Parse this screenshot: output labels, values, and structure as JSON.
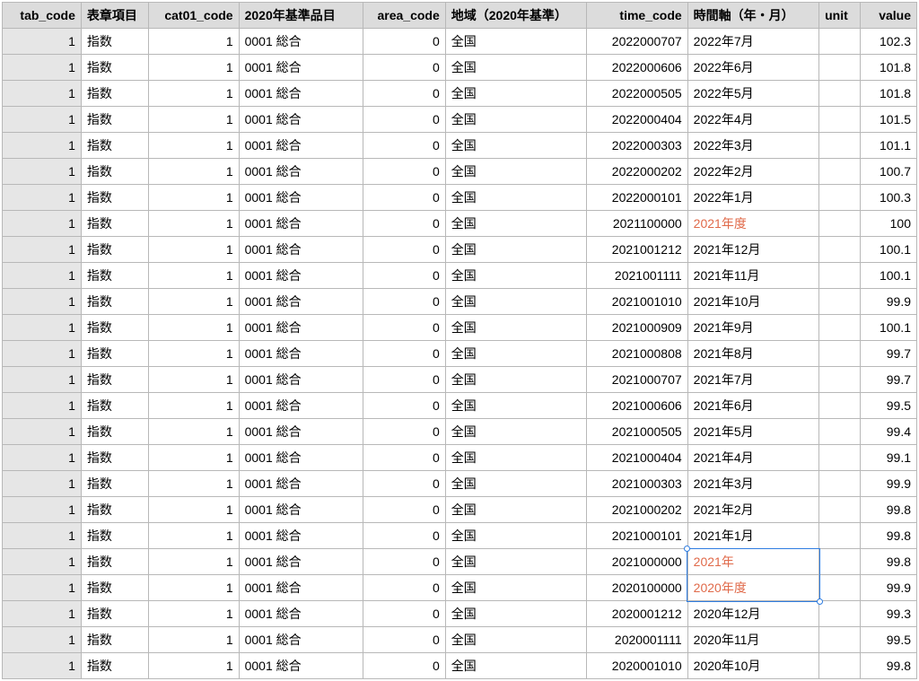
{
  "columns": [
    {
      "key": "tab_code",
      "label": "tab_code",
      "type": "num"
    },
    {
      "key": "hyosho",
      "label": "表章項目",
      "type": "txt"
    },
    {
      "key": "cat01_code",
      "label": "cat01_code",
      "type": "num"
    },
    {
      "key": "hinmoku",
      "label": "2020年基準品目",
      "type": "txt"
    },
    {
      "key": "area_code",
      "label": "area_code",
      "type": "num"
    },
    {
      "key": "chiiki",
      "label": "地域（2020年基準）",
      "type": "txt"
    },
    {
      "key": "time_code",
      "label": "time_code",
      "type": "num"
    },
    {
      "key": "time",
      "label": "時間軸（年・月）",
      "type": "txt"
    },
    {
      "key": "unit",
      "label": "unit",
      "type": "txt"
    },
    {
      "key": "value",
      "label": "value",
      "type": "val"
    }
  ],
  "base": {
    "tab_code": "1",
    "hyosho": "指数",
    "cat01_code": "1",
    "hinmoku": "0001 総合",
    "area_code": "0",
    "chiiki": "全国",
    "unit": ""
  },
  "rows": [
    {
      "time_code": "2022000707",
      "time": "2022年7月",
      "value": "102.3"
    },
    {
      "time_code": "2022000606",
      "time": "2022年6月",
      "value": "101.8"
    },
    {
      "time_code": "2022000505",
      "time": "2022年5月",
      "value": "101.8"
    },
    {
      "time_code": "2022000404",
      "time": "2022年4月",
      "value": "101.5"
    },
    {
      "time_code": "2022000303",
      "time": "2022年3月",
      "value": "101.1"
    },
    {
      "time_code": "2022000202",
      "time": "2022年2月",
      "value": "100.7"
    },
    {
      "time_code": "2022000101",
      "time": "2022年1月",
      "value": "100.3"
    },
    {
      "time_code": "2021100000",
      "time": "2021年度",
      "value": "100",
      "highlight_time": true
    },
    {
      "time_code": "2021001212",
      "time": "2021年12月",
      "value": "100.1"
    },
    {
      "time_code": "2021001111",
      "time": "2021年11月",
      "value": "100.1"
    },
    {
      "time_code": "2021001010",
      "time": "2021年10月",
      "value": "99.9"
    },
    {
      "time_code": "2021000909",
      "time": "2021年9月",
      "value": "100.1"
    },
    {
      "time_code": "2021000808",
      "time": "2021年8月",
      "value": "99.7"
    },
    {
      "time_code": "2021000707",
      "time": "2021年7月",
      "value": "99.7"
    },
    {
      "time_code": "2021000606",
      "time": "2021年6月",
      "value": "99.5"
    },
    {
      "time_code": "2021000505",
      "time": "2021年5月",
      "value": "99.4"
    },
    {
      "time_code": "2021000404",
      "time": "2021年4月",
      "value": "99.1"
    },
    {
      "time_code": "2021000303",
      "time": "2021年3月",
      "value": "99.9"
    },
    {
      "time_code": "2021000202",
      "time": "2021年2月",
      "value": "99.8"
    },
    {
      "time_code": "2021000101",
      "time": "2021年1月",
      "value": "99.8"
    },
    {
      "time_code": "2021000000",
      "time": "2021年",
      "value": "99.8",
      "highlight_time": true,
      "select_anchor": "start"
    },
    {
      "time_code": "2020100000",
      "time": "2020年度",
      "value": "99.9",
      "highlight_time": true,
      "select_anchor": "end"
    },
    {
      "time_code": "2020001212",
      "time": "2020年12月",
      "value": "99.3"
    },
    {
      "time_code": "2020001111",
      "time": "2020年11月",
      "value": "99.5"
    },
    {
      "time_code": "2020001010",
      "time": "2020年10月",
      "value": "99.8"
    }
  ],
  "col_classes": [
    "c-tab",
    "c-hyo",
    "c-cat",
    "c-hin",
    "c-area",
    "c-chi",
    "c-tc",
    "c-time",
    "c-unit",
    "c-val"
  ]
}
